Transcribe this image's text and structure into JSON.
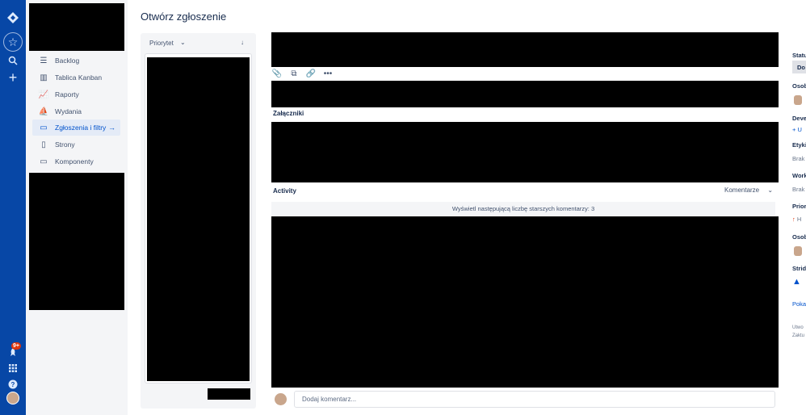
{
  "page": {
    "title": "Otwórz zgłoszenie"
  },
  "sidebar": {
    "items": [
      {
        "label": "Backlog",
        "icon": "backlog-icon"
      },
      {
        "label": "Tablica Kanban",
        "icon": "board-icon"
      },
      {
        "label": "Raporty",
        "icon": "reports-icon"
      },
      {
        "label": "Wydania",
        "icon": "releases-icon"
      },
      {
        "label": "Zgłoszenia i filtry",
        "icon": "issues-icon",
        "active": true
      },
      {
        "label": "Strony",
        "icon": "pages-icon"
      },
      {
        "label": "Komponenty",
        "icon": "components-icon"
      }
    ]
  },
  "global_nav": {
    "notifications_badge": "9+"
  },
  "list": {
    "sort_label": "Priorytet"
  },
  "issue": {
    "attachments_label": "Załączniki",
    "activity_label": "Activity",
    "activity_filter": "Komentarze",
    "older_comments": "Wyświetl następującą liczbę starszych komentarzy: 3",
    "comment_placeholder": "Dodaj komentarz..."
  },
  "details": {
    "status_label": "Statu",
    "status_value": "Do",
    "assignee_label": "Osob",
    "development_label": "Deve",
    "development_value": "U",
    "labels_label": "Etyki",
    "labels_value": "Brak",
    "work_label": "Work",
    "work_value": "Brak",
    "priority_label": "Prior",
    "priority_value": "H",
    "reporter_label": "Osob",
    "strides_label": "Strid",
    "show_more": "Poka",
    "created": "Utwo",
    "updated": "Zaktu"
  },
  "colors": {
    "nav": "#0747a6",
    "accent": "#0052cc",
    "sidebar_bg": "#f4f5f7"
  }
}
